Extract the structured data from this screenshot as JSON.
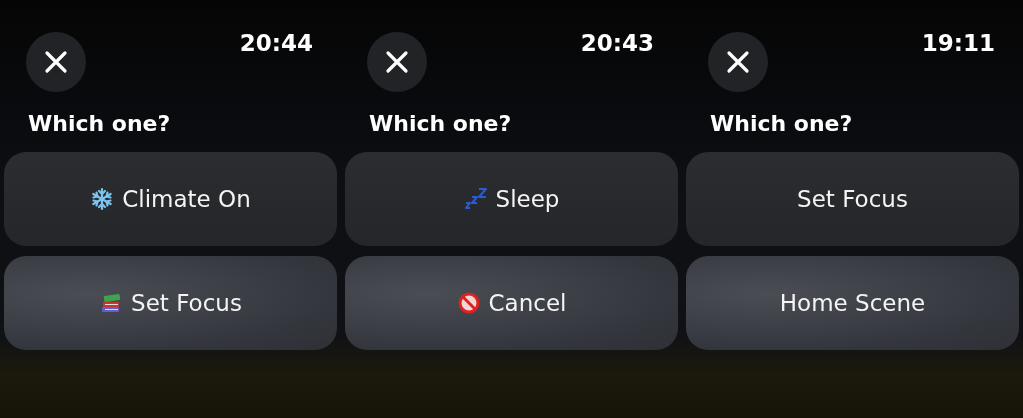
{
  "screens": [
    {
      "time": "20:44",
      "title": "Which one?",
      "options": [
        {
          "label": "Climate On",
          "kind": "snowflake"
        },
        {
          "label": "Set Focus",
          "kind": "books"
        }
      ]
    },
    {
      "time": "20:43",
      "title": "Which one?",
      "options": [
        {
          "label": "Sleep",
          "kind": "sleep"
        },
        {
          "label": "Cancel",
          "kind": "no-entry"
        }
      ]
    },
    {
      "time": "19:11",
      "title": "Which one?",
      "options": [
        {
          "label": "Set Focus",
          "kind": "plain"
        },
        {
          "label": "Home Scene",
          "kind": "plain"
        }
      ]
    }
  ]
}
